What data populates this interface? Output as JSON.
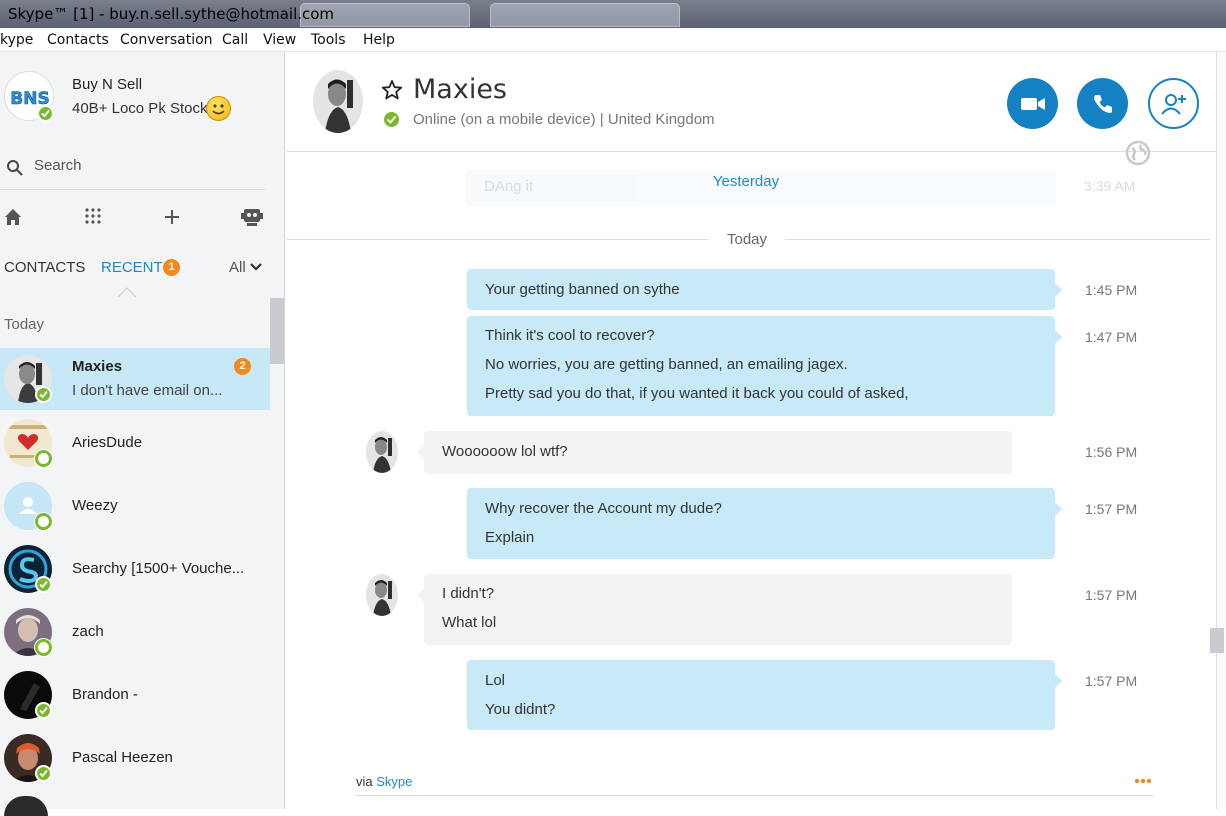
{
  "window": {
    "title": "Skype™ [1] - buy.n.sell.sythe@hotmail.com"
  },
  "menu": [
    "kype",
    "Contacts",
    "Conversation",
    "Call",
    "View",
    "Tools",
    "Help"
  ],
  "profile": {
    "name": "Buy N Sell",
    "mood": "40B+ Loco Pk Stock",
    "avatar_text": "BNS"
  },
  "search": {
    "placeholder": "Search"
  },
  "tabs": {
    "contacts": "CONTACTS",
    "recent": "RECENT",
    "recent_badge": "1",
    "filter": "All"
  },
  "list": {
    "section": "Today",
    "contacts": [
      {
        "name": "Maxies",
        "message": "I don't have email on...",
        "badge": "2",
        "status": "online"
      },
      {
        "name": "AriesDude",
        "status": "away"
      },
      {
        "name": "Weezy",
        "status": "away"
      },
      {
        "name": "Searchy [1500+ Vouche...",
        "status": "online"
      },
      {
        "name": "zach",
        "status": "away"
      },
      {
        "name": "Brandon -",
        "status": "online"
      },
      {
        "name": "Pascal Heezen",
        "status": "online"
      }
    ]
  },
  "conversation": {
    "name": "Maxies",
    "status": "Online (on a mobile device)  |  United Kingdom",
    "yesterday_label": "Yesterday",
    "yesterday_ghost_text": "DAng it",
    "yesterday_ghost_time": "3:39 AM",
    "today_label": "Today",
    "messages": [
      {
        "direction": "out",
        "lines": [
          "Your getting banned on sythe"
        ],
        "time": "1:45 PM"
      },
      {
        "direction": "out",
        "lines": [
          "Think it's cool to recover?",
          "No worries, you are getting banned, an emailing jagex.",
          "Pretty sad you do that, if you wanted it back you could of asked,"
        ],
        "time": "1:47 PM"
      },
      {
        "direction": "in",
        "lines": [
          "Woooooow lol wtf?"
        ],
        "time": "1:56 PM"
      },
      {
        "direction": "out",
        "lines": [
          "Why recover the Account my dude?",
          "Explain"
        ],
        "time": "1:57 PM"
      },
      {
        "direction": "in",
        "lines": [
          "I didn't?",
          "What lol"
        ],
        "time": "1:57 PM"
      },
      {
        "direction": "out",
        "lines": [
          "Lol",
          "You didnt?"
        ],
        "time": "1:57 PM"
      }
    ],
    "via_prefix": "via",
    "via_link": "Skype"
  },
  "colors": {
    "accent": "#1481c3",
    "online": "#7cb82f",
    "badge": "#f18a1c",
    "bubble_out": "#c7e9f8",
    "bubble_in": "#f1f3f5"
  }
}
